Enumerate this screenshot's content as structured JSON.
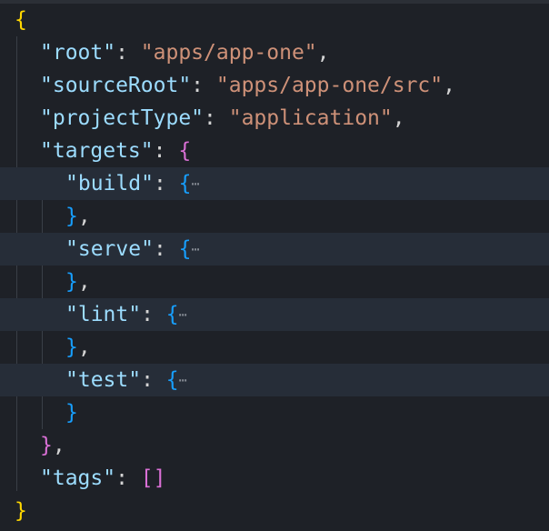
{
  "editor": {
    "colors": {
      "background": "#1e2127",
      "key": "#9cdcfe",
      "string": "#ce9178",
      "bracket_level_1": "#ffd700",
      "bracket_level_2": "#da70d6",
      "bracket_level_3": "#179fff",
      "highlight": "#262d38"
    },
    "lines": [
      {
        "open": "{"
      },
      {
        "key": "\"root\"",
        "colon": ": ",
        "value": "\"apps/app-one\"",
        "comma": ","
      },
      {
        "key": "\"sourceRoot\"",
        "colon": ": ",
        "value": "\"apps/app-one/src\"",
        "comma": ","
      },
      {
        "key": "\"projectType\"",
        "colon": ": ",
        "value": "\"application\"",
        "comma": ","
      },
      {
        "key": "\"targets\"",
        "colon": ": ",
        "open": "{"
      },
      {
        "key": "\"build\"",
        "colon": ": ",
        "open": "{",
        "fold": "⋯"
      },
      {
        "close": "}",
        "comma": ","
      },
      {
        "key": "\"serve\"",
        "colon": ": ",
        "open": "{",
        "fold": "⋯"
      },
      {
        "close": "}",
        "comma": ","
      },
      {
        "key": "\"lint\"",
        "colon": ": ",
        "open": "{",
        "fold": "⋯"
      },
      {
        "close": "}",
        "comma": ","
      },
      {
        "key": "\"test\"",
        "colon": ": ",
        "open": "{",
        "fold": "⋯"
      },
      {
        "close": "}"
      },
      {
        "close": "}",
        "comma": ","
      },
      {
        "key": "\"tags\"",
        "colon": ": ",
        "value": "[]"
      },
      {
        "close": "}"
      }
    ]
  }
}
